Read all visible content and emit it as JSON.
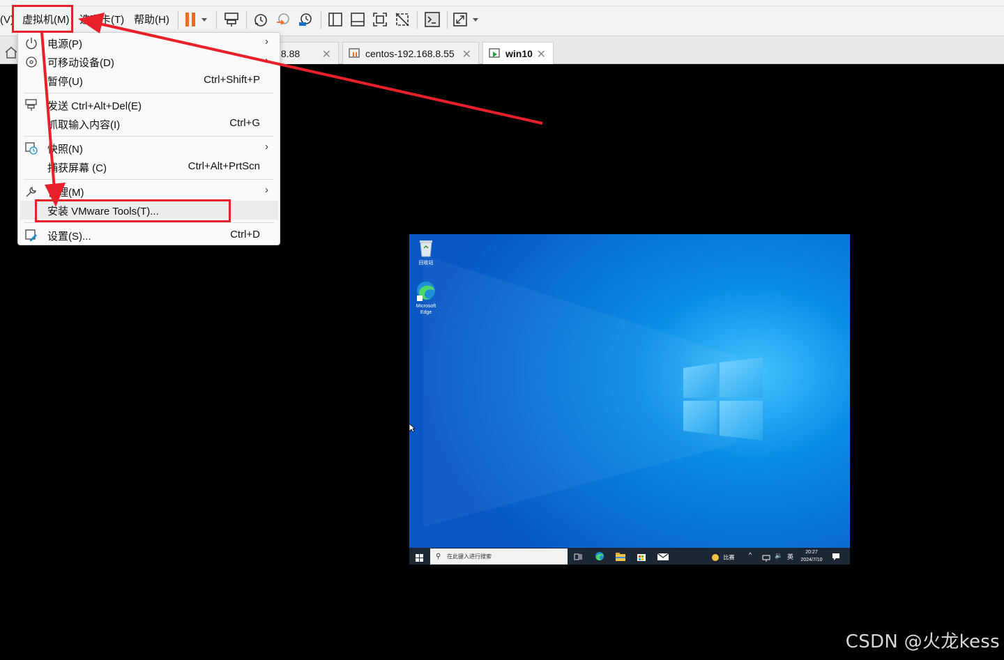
{
  "menubar": {
    "items": [
      {
        "label": "(V)"
      },
      {
        "label": "虚拟机(M)"
      },
      {
        "label": "选项卡(T)"
      },
      {
        "label": "帮助(H)"
      }
    ]
  },
  "tabs": [
    {
      "label": ".8.88"
    },
    {
      "label": "centos-192.168.8.55"
    },
    {
      "label": "win10",
      "active": true
    }
  ],
  "vm_menu": {
    "items": [
      {
        "label": "电源(P)",
        "shortcut": "",
        "submenu": true,
        "icon": "power-icon"
      },
      {
        "label": "可移动设备(D)",
        "shortcut": "",
        "submenu": true,
        "icon": "disc-icon"
      },
      {
        "label": "暂停(U)",
        "shortcut": "Ctrl+Shift+P",
        "submenu": false,
        "icon": ""
      },
      {
        "label": "发送 Ctrl+Alt+Del(E)",
        "shortcut": "",
        "submenu": false,
        "icon": "send-cad-icon"
      },
      {
        "label": "抓取输入内容(I)",
        "shortcut": "Ctrl+G",
        "submenu": false,
        "icon": ""
      },
      {
        "label": "快照(N)",
        "shortcut": "",
        "submenu": true,
        "icon": "snapshot-icon"
      },
      {
        "label": "捕获屏幕 (C)",
        "shortcut": "Ctrl+Alt+PrtScn",
        "submenu": false,
        "icon": ""
      },
      {
        "label": "管理(M)",
        "shortcut": "",
        "submenu": true,
        "icon": "wrench-icon"
      },
      {
        "label": "安装 VMware Tools(T)...",
        "shortcut": "",
        "submenu": false,
        "icon": ""
      },
      {
        "label": "设置(S)...",
        "shortcut": "Ctrl+D",
        "submenu": false,
        "icon": "settings-icon"
      }
    ]
  },
  "guest": {
    "desktop_icons": [
      {
        "label": "回收站"
      },
      {
        "label": "Microsoft Edge"
      }
    ],
    "taskbar": {
      "search_placeholder": "在此键入进行搜索",
      "weather": "比赛",
      "ime": "英",
      "time": "20:27",
      "date": "2024/7/10"
    }
  },
  "watermark": "CSDN @火龙kess",
  "colors": {
    "annotation_red": "#e8202a",
    "pause_orange": "#f26b1d",
    "desktop_blue": "#0a78d7",
    "taskbar": "#1d2733"
  }
}
